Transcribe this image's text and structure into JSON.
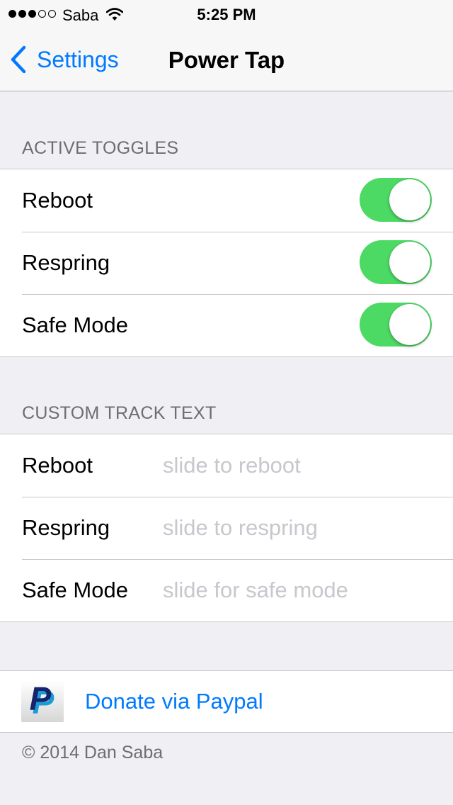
{
  "status_bar": {
    "signal_bars_filled": 3,
    "signal_bars_total": 5,
    "carrier": "Saba",
    "time": "5:25 PM"
  },
  "nav": {
    "back_label": "Settings",
    "title": "Power Tap"
  },
  "active_toggles": {
    "header": "ACTIVE TOGGLES",
    "items": [
      {
        "label": "Reboot",
        "on": true
      },
      {
        "label": "Respring",
        "on": true
      },
      {
        "label": "Safe Mode",
        "on": true
      }
    ]
  },
  "custom_track_text": {
    "header": "CUSTOM TRACK TEXT",
    "items": [
      {
        "label": "Reboot",
        "value": "",
        "placeholder": "slide to reboot"
      },
      {
        "label": "Respring",
        "value": "",
        "placeholder": "slide to respring"
      },
      {
        "label": "Safe Mode",
        "value": "",
        "placeholder": "slide for safe mode"
      }
    ]
  },
  "donate": {
    "label": "Donate via Paypal",
    "icon": "paypal-icon"
  },
  "footer": {
    "copyright": "© 2014 Dan Saba"
  },
  "colors": {
    "accent": "#007aff",
    "switch_on": "#4cd964",
    "background": "#efeff4",
    "section_header": "#6d6d72",
    "placeholder": "#c7c7cd"
  }
}
